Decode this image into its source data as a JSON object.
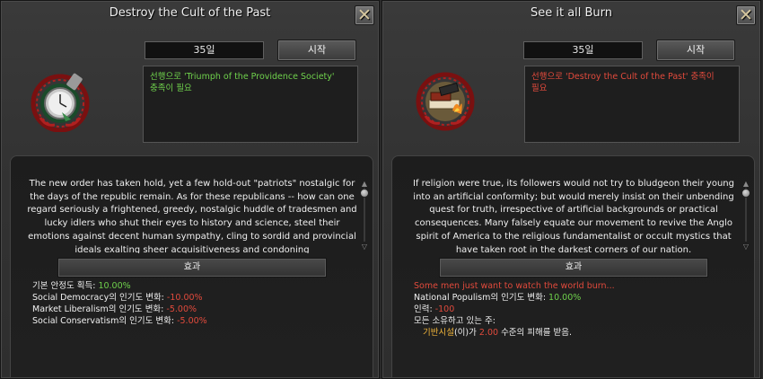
{
  "left": {
    "title": "Destroy the Cult of the Past",
    "close_icon": "close-x-icon",
    "days": "35일",
    "start_label": "시작",
    "emblem_icon": "pocket-watch-emblem-icon",
    "prereq": {
      "line1_prefix": "선행으로 '",
      "line1_name": "Triumph of the Providence Society",
      "line1_suffix": "'",
      "line2": "충족이 필요",
      "color": "#6fd14c"
    },
    "description": "The new order has taken hold, yet a few hold-out \"patriots\" nostalgic for the days of the republic remain. As for these republicans -- how can one regard seriously a frightened, greedy, nostalgic huddle of tradesmen and lucky idlers who shut their eyes to history and science, steel their emotions against decent human sympathy, cling to sordid and provincial ideals exalting sheer acquisitiveness and condoning",
    "effect_label": "효과",
    "effects": [
      {
        "label": "기본 안정도 획득: ",
        "value": "10.00%",
        "color": "green"
      },
      {
        "label": "Social Democracy의 인기도 변화: ",
        "value": "-10.00%",
        "color": "red"
      },
      {
        "label": "Market Liberalism의 인기도 변화: ",
        "value": "-5.00%",
        "color": "red"
      },
      {
        "label": "Social Conservatism의 인기도 변화: ",
        "value": "-5.00%",
        "color": "red"
      }
    ]
  },
  "right": {
    "title": "See it all Burn",
    "close_icon": "close-x-icon",
    "days": "35일",
    "start_label": "시작",
    "emblem_icon": "burning-books-emblem-icon",
    "prereq": {
      "line1_prefix": "선행으로 '",
      "line1_name": "Destroy the Cult of the Past",
      "line1_suffix": "' 충족이",
      "line2": "필요",
      "color": "#e14a3c"
    },
    "description": "If religion were true, its followers would not try to bludgeon their young into an artificial conformity; but would merely insist on their unbending quest for truth, irrespective of artificial backgrounds or practical consequences. Many falsely equate our movement to revive the Anglo spirit of America to the religious fundamentalist or occult mystics that have taken root in the darkest corners of our nation.",
    "effect_label": "효과",
    "flavor": "Some men just want to watch the world burn...",
    "effects": [
      {
        "label": "National Populism의 인기도 변화: ",
        "value": "10.00%",
        "color": "green"
      },
      {
        "label": "인력: ",
        "value": "-100",
        "color": "red"
      }
    ],
    "all_owned_label": "모든 소유하고 있는 주:",
    "damage": {
      "building": "기반시설",
      "mid": "(이)가 ",
      "amount": "2.00",
      "suffix": " 수준의 피해를 받음."
    }
  }
}
